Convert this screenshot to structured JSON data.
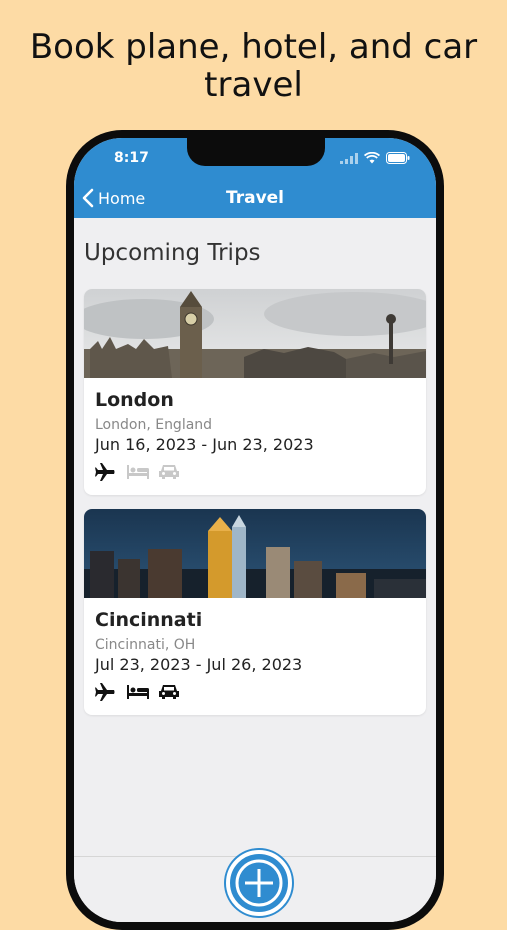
{
  "headline": "Book plane, hotel, and car travel",
  "status_bar": {
    "time": "8:17"
  },
  "nav": {
    "back_label": "Home",
    "title": "Travel"
  },
  "section_title": "Upcoming Trips",
  "trips": [
    {
      "name": "London",
      "location": "London, England",
      "dates": "Jun 16, 2023 - Jun 23, 2023",
      "icons": [
        "plane-icon",
        "hotel-icon",
        "car-icon"
      ],
      "active": [
        true,
        false,
        false
      ]
    },
    {
      "name": "Cincinnati",
      "location": "Cincinnati, OH",
      "dates": "Jul 23, 2023 - Jul 26, 2023",
      "icons": [
        "plane-icon",
        "hotel-icon",
        "car-icon"
      ],
      "active": [
        true,
        true,
        true
      ]
    }
  ],
  "colors": {
    "accent": "#2F8CD0",
    "background": "#FDDBA5",
    "inactive_icon": "#c8c8c8"
  }
}
